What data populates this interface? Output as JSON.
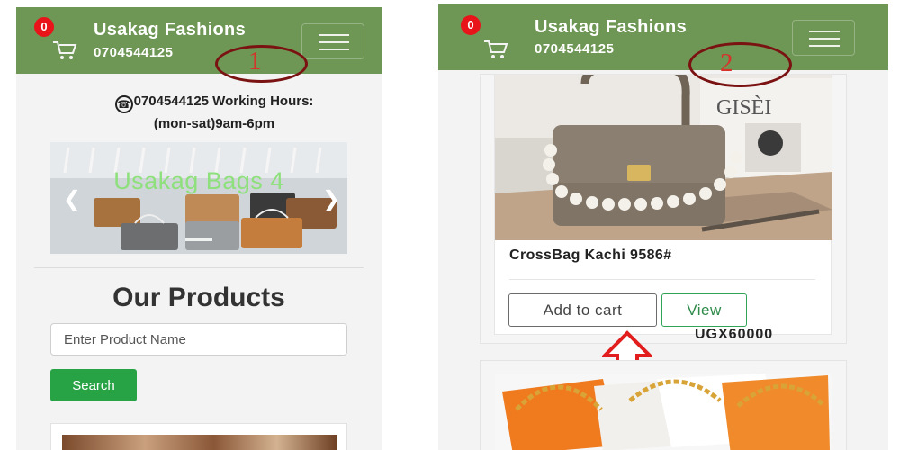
{
  "header": {
    "brand": "Usakag Fashions",
    "phone": "0704544125",
    "cart_count": "0"
  },
  "steps": [
    "1",
    "2"
  ],
  "phone1": {
    "contact_line1": "0704544125 Working Hours:",
    "contact_line2": "(mon-sat)9am-6pm",
    "carousel_caption": "Usakag Bags 4",
    "products_title": "Our Products",
    "search_placeholder": "Enter Product Name",
    "search_button": "Search"
  },
  "phone2": {
    "product_name": "CrossBag Kachi 9586#",
    "add_to_cart": "Add to cart",
    "view": "View",
    "price": "UGX60000",
    "image_sign": "GISÈI"
  },
  "colors": {
    "navbar": "#6e9654",
    "badge": "#e8141a",
    "search_button": "#27a345",
    "view_border": "#31a357",
    "annotation": "#7a1212",
    "arrow": "#e11d1d"
  },
  "icons": {
    "cart": "shopping-cart-icon",
    "menu": "hamburger-menu-icon",
    "phone": "telephone-icon",
    "carousel_prev": "chevron-left-icon",
    "carousel_next": "chevron-right-icon",
    "annotation_arrow": "up-arrow-icon"
  }
}
